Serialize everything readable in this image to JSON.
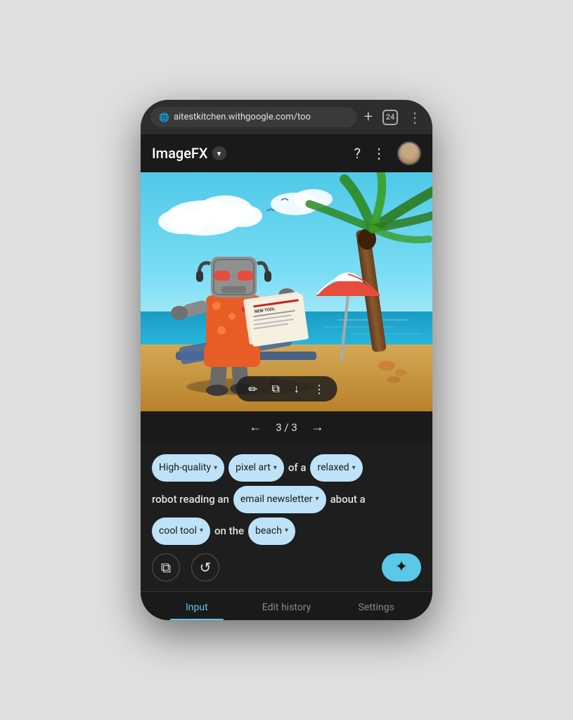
{
  "browser": {
    "url": "aitestkitchen.withgoogle.com/too",
    "tabs_count": "24",
    "url_icon": "🌐"
  },
  "app": {
    "title": "ImageFX",
    "help_icon": "?",
    "menu_icon": "⋮",
    "dropdown_icon": "▾"
  },
  "image": {
    "alt": "AI generated beach scene with robot in hawaiian shirt",
    "current_page": "3",
    "total_pages": "3"
  },
  "image_controls": {
    "edit_icon": "✏",
    "copy_icon": "⧉",
    "download_icon": "↓",
    "more_icon": "⋮"
  },
  "prompt": {
    "tokens": [
      {
        "id": "quality",
        "label": "High-quality"
      },
      {
        "id": "style",
        "label": "pixel art"
      }
    ],
    "text_of_a": "of a",
    "text_robot": "robot reading an",
    "text_newsletter": "email newsletter",
    "tokens2": [
      {
        "id": "mood",
        "label": "relaxed"
      }
    ],
    "text_about": "about a",
    "tokens3": [
      {
        "id": "subject",
        "label": "cool tool"
      }
    ],
    "text_on_the": "on the",
    "tokens4": [
      {
        "id": "location",
        "label": "beach"
      }
    ]
  },
  "toolbar": {
    "copy_label": "copy",
    "refresh_label": "refresh",
    "generate_icon": "✦"
  },
  "tabs": [
    {
      "id": "input",
      "label": "Input",
      "active": true
    },
    {
      "id": "edit-history",
      "label": "Edit history",
      "active": false
    },
    {
      "id": "settings",
      "label": "Settings",
      "active": false
    }
  ],
  "colors": {
    "accent": "#5bc8e8",
    "chip_bg": "#bee3f8",
    "bg_dark": "#1a1a1a",
    "bg_panel": "#1e1e1e"
  }
}
